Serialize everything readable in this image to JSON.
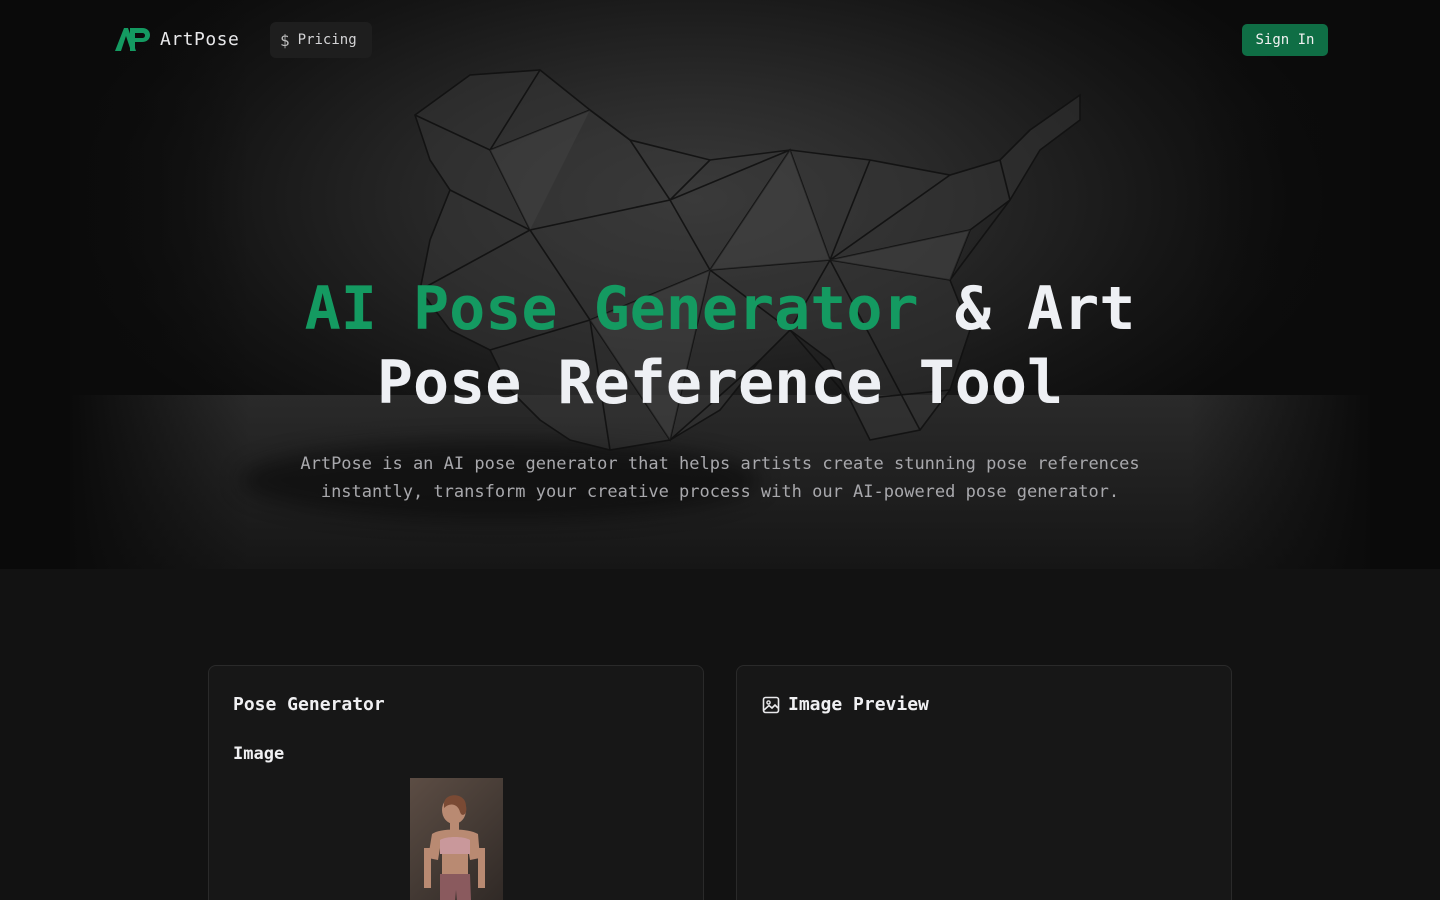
{
  "nav": {
    "brand": "ArtPose",
    "pricing_label": "Pricing",
    "pricing_icon": "dollar-icon",
    "signin_label": "Sign In"
  },
  "hero": {
    "title_accent": "AI Pose Generator",
    "title_rest_line1": " & Art",
    "title_line2": "Pose Reference Tool",
    "subtitle_line1": "ArtPose is an AI pose generator that helps artists create stunning pose references",
    "subtitle_line2": "instantly, transform your creative process with our AI-powered pose generator."
  },
  "generator": {
    "title": "Pose Generator",
    "image_label": "Image"
  },
  "preview": {
    "title": "Image Preview",
    "icon": "image-icon"
  },
  "colors": {
    "accent": "#149a61",
    "button": "#0f6e45",
    "background": "#121212"
  }
}
